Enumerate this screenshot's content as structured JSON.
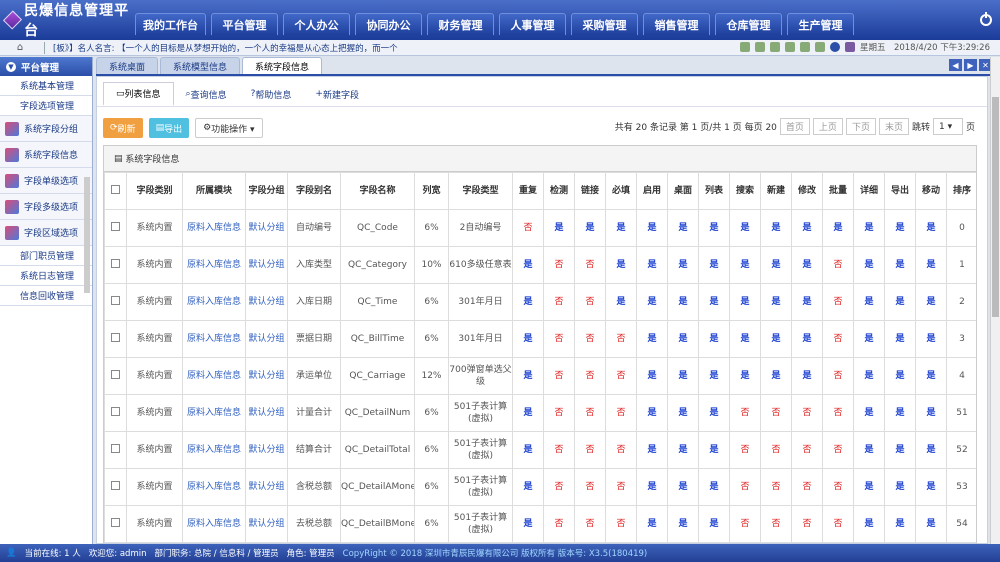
{
  "logo": "民爆信息管理平台",
  "nav": [
    "我的工作台",
    "平台管理",
    "个人办公",
    "协同办公",
    "财务管理",
    "人事管理",
    "采购管理",
    "销售管理",
    "仓库管理",
    "生产管理"
  ],
  "marquee": "[板》】名人名言: 【一个人的目标是从梦想开始的，一个人的幸福是从心态上把握的，而一个",
  "datetime": "星期五　2018/4/20 下午3:29:26",
  "sidebar": {
    "header": "平台管理",
    "items": [
      "系统基本管理",
      "字段选项管理"
    ],
    "subitems": [
      "系统字段分组",
      "系统字段信息",
      "字段单级选项",
      "字段多级选项",
      "字段区域选项"
    ],
    "items2": [
      "部门职员管理",
      "系统日志管理",
      "信息回收管理"
    ]
  },
  "tabs": [
    "系统桌面",
    "系统模型信息",
    "系统字段信息"
  ],
  "subtabs": [
    "列表信息",
    "查询信息",
    "帮助信息",
    "新建字段"
  ],
  "buttons": {
    "refresh": "刷新",
    "export": "导出",
    "func": "功能操作 ▾"
  },
  "pager": {
    "info": "共有 20 条记录 第 1 页/共 1 页 每页 20",
    "first": "首页",
    "prev": "上页",
    "next": "下页",
    "last": "末页",
    "jump": "跳转",
    "page": "1",
    "unit": "页"
  },
  "panel_title": "系统字段信息",
  "headers": [
    "",
    "字段类别",
    "所属模块",
    "字段分组",
    "字段别名",
    "字段名称",
    "列宽",
    "字段类型",
    "重复",
    "检测",
    "链接",
    "必填",
    "启用",
    "桌面",
    "列表",
    "搜索",
    "新建",
    "修改",
    "批量",
    "详细",
    "导出",
    "移动",
    "排序",
    "修改"
  ],
  "rows": [
    [
      "系统内置",
      "原料入库信息",
      "默认分组",
      "自动编号",
      "QC_Code",
      "6%",
      "2自动编号",
      "否",
      "是",
      "是",
      "是",
      "是",
      "是",
      "是",
      "是",
      "是",
      "是",
      "是",
      "是",
      "是",
      "是",
      "0"
    ],
    [
      "系统内置",
      "原料入库信息",
      "默认分组",
      "入库类型",
      "QC_Category",
      "10%",
      "610多级任意表",
      "是",
      "否",
      "否",
      "是",
      "是",
      "是",
      "是",
      "是",
      "是",
      "是",
      "否",
      "是",
      "是",
      "是",
      "1"
    ],
    [
      "系统内置",
      "原料入库信息",
      "默认分组",
      "入库日期",
      "QC_Time",
      "6%",
      "301年月日",
      "是",
      "否",
      "否",
      "是",
      "是",
      "是",
      "是",
      "是",
      "是",
      "是",
      "否",
      "是",
      "是",
      "是",
      "2"
    ],
    [
      "系统内置",
      "原料入库信息",
      "默认分组",
      "票据日期",
      "QC_BillTime",
      "6%",
      "301年月日",
      "是",
      "否",
      "否",
      "否",
      "是",
      "是",
      "是",
      "是",
      "是",
      "是",
      "否",
      "是",
      "是",
      "是",
      "3"
    ],
    [
      "系统内置",
      "原料入库信息",
      "默认分组",
      "承运单位",
      "QC_Carriage",
      "12%",
      "700弹窗单选父级",
      "是",
      "否",
      "否",
      "否",
      "是",
      "是",
      "是",
      "是",
      "是",
      "是",
      "否",
      "是",
      "是",
      "是",
      "4"
    ],
    [
      "系统内置",
      "原料入库信息",
      "默认分组",
      "计量合计",
      "QC_DetailNum",
      "6%",
      "501子表计算(虚拟)",
      "是",
      "否",
      "否",
      "否",
      "是",
      "是",
      "是",
      "否",
      "否",
      "否",
      "否",
      "是",
      "是",
      "是",
      "51"
    ],
    [
      "系统内置",
      "原料入库信息",
      "默认分组",
      "结算合计",
      "QC_DetailTotal",
      "6%",
      "501子表计算(虚拟)",
      "是",
      "否",
      "否",
      "否",
      "是",
      "是",
      "是",
      "否",
      "否",
      "否",
      "否",
      "是",
      "是",
      "是",
      "52"
    ],
    [
      "系统内置",
      "原料入库信息",
      "默认分组",
      "含税总额",
      "QC_DetailAMoney",
      "6%",
      "501子表计算(虚拟)",
      "是",
      "否",
      "否",
      "否",
      "是",
      "是",
      "是",
      "否",
      "否",
      "否",
      "否",
      "是",
      "是",
      "是",
      "53"
    ],
    [
      "系统内置",
      "原料入库信息",
      "默认分组",
      "去税总额",
      "QC_DetailBMoney",
      "6%",
      "501子表计算(虚拟)",
      "是",
      "否",
      "否",
      "否",
      "是",
      "是",
      "是",
      "否",
      "否",
      "否",
      "否",
      "是",
      "是",
      "是",
      "54"
    ]
  ],
  "footer": {
    "online": "当前在线: 1 人",
    "welcome": "欢迎您: admin",
    "dept": "部门职务: 总院 / 信息科 / 管理员",
    "role": "角色: 管理员",
    "copy": "CopyRight © 2018  深圳市青辰民爆有限公司 版权所有  版本号: X3.5(180419)"
  }
}
